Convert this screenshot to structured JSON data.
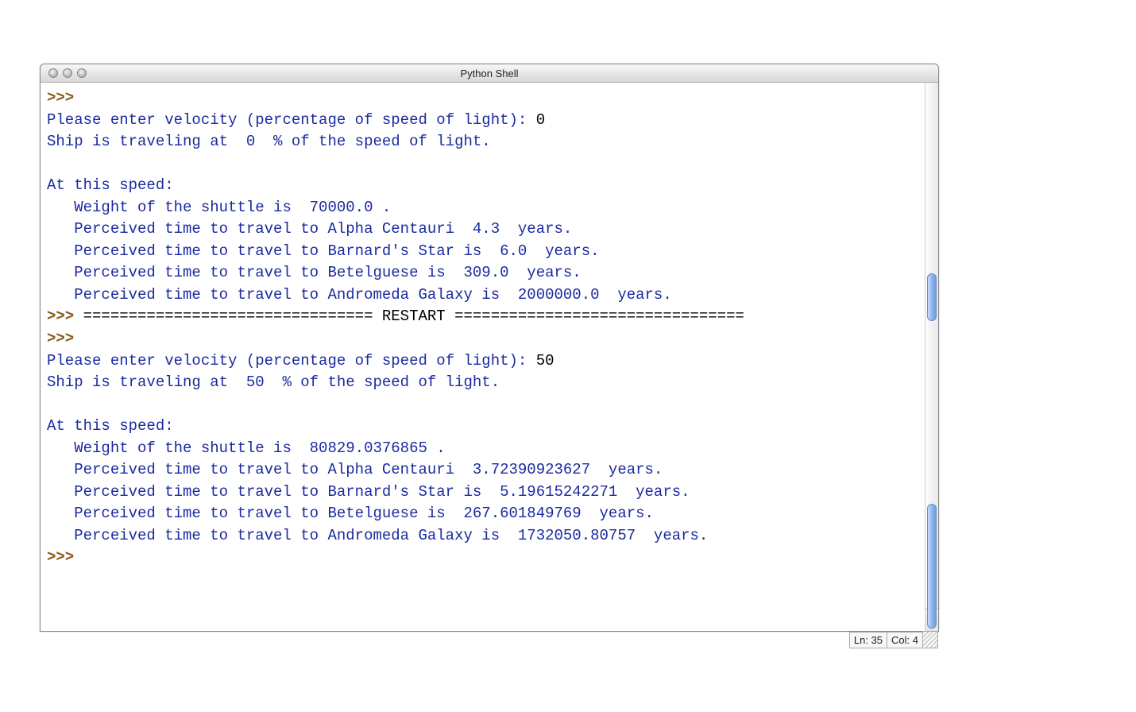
{
  "window": {
    "title": "Python Shell"
  },
  "status": {
    "line_label": "Ln: ",
    "line_value": "35",
    "col_label": "Col: ",
    "col_value": "4"
  },
  "session1": {
    "prompt1": ">>> ",
    "question": "Please enter velocity (percentage of speed of light): ",
    "answer": "0",
    "line_travel": "Ship is traveling at  0  % of the speed of light.",
    "blank": "",
    "heading": "At this speed:",
    "l1": "   Weight of the shuttle is  70000.0 .",
    "l2": "   Perceived time to travel to Alpha Centauri  4.3  years.",
    "l3": "   Perceived time to travel to Barnard's Star is  6.0  years.",
    "l4": "   Perceived time to travel to Betelguese is  309.0  years.",
    "l5": "   Perceived time to travel to Andromeda Galaxy is  2000000.0  years."
  },
  "restart": {
    "prompt": ">>> ",
    "text": "================================ RESTART ================================"
  },
  "session2": {
    "prompt1": ">>> ",
    "question": "Please enter velocity (percentage of speed of light): ",
    "answer": "50",
    "line_travel": "Ship is traveling at  50  % of the speed of light.",
    "blank": "",
    "heading": "At this speed:",
    "l1": "   Weight of the shuttle is  80829.0376865 .",
    "l2": "   Perceived time to travel to Alpha Centauri  3.72390923627  years.",
    "l3": "   Perceived time to travel to Barnard's Star is  5.19615242271  years.",
    "l4": "   Perceived time to travel to Betelguese is  267.601849769  years.",
    "l5": "   Perceived time to travel to Andromeda Galaxy is  1732050.80757  years.",
    "final_prompt": ">>> "
  }
}
